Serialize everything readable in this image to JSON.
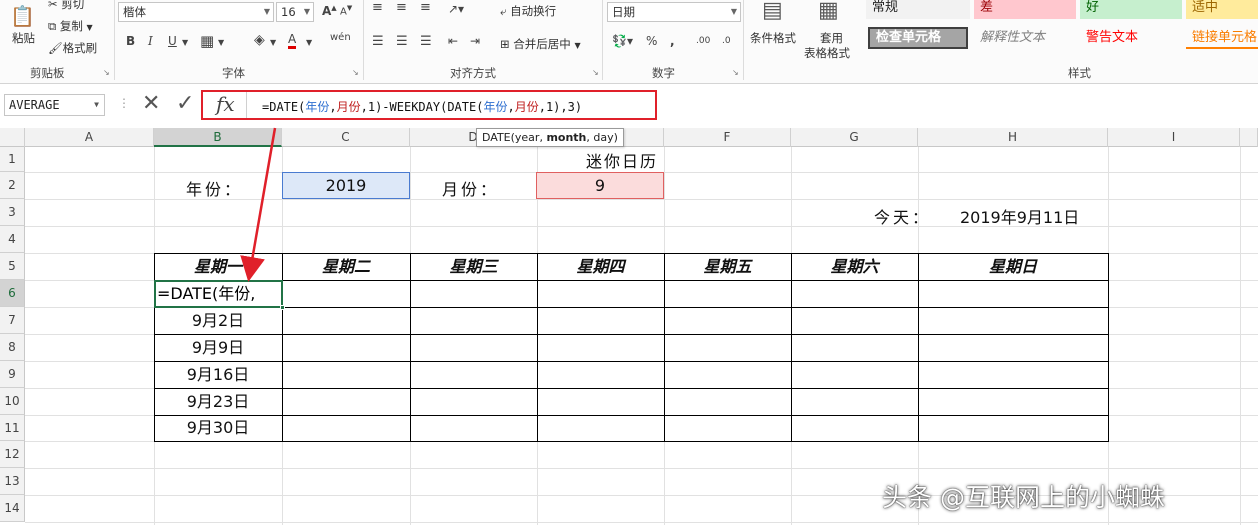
{
  "ribbon": {
    "clipboard": {
      "cut": "剪切",
      "copy": "复制",
      "paste": "粘贴",
      "format_painter": "格式刷",
      "label": "剪贴板"
    },
    "font": {
      "name": "楷体",
      "size": "16",
      "bold": "B",
      "italic": "I",
      "underline": "U",
      "grow": "A",
      "shrink": "A",
      "color_a": "A",
      "wen": "wén",
      "label": "字体"
    },
    "alignment": {
      "wrap": "自动换行",
      "merge": "合并后居中",
      "label": "对齐方式"
    },
    "number": {
      "format": "日期",
      "percent": "%",
      "comma": ",",
      "label": "数字"
    },
    "styles": {
      "conditional": "条件格式",
      "table_format_1": "套用",
      "table_format_2": "表格格式",
      "label": "样式",
      "cells": [
        "常规",
        "差",
        "好",
        "适中",
        "检查单元格",
        "解释性文本",
        "警告文本",
        "链接单元格"
      ]
    }
  },
  "formula_bar": {
    "name_box": "AVERAGE",
    "cancel": "✕",
    "enter": "✓",
    "fx": "fx",
    "tokens": [
      {
        "t": "=DATE(",
        "c": "n"
      },
      {
        "t": "年份",
        "c": "b"
      },
      {
        "t": ",",
        "c": "n"
      },
      {
        "t": "月份",
        "c": "r"
      },
      {
        "t": ",1)-WEEKDAY(DATE(",
        "c": "n"
      },
      {
        "t": "年份",
        "c": "b"
      },
      {
        "t": ",",
        "c": "n"
      },
      {
        "t": "月份",
        "c": "r"
      },
      {
        "t": ",1),3)",
        "c": "n"
      }
    ],
    "tooltip_pre": "DATE(year, ",
    "tooltip_bold": "month",
    "tooltip_post": ", day)"
  },
  "columns": [
    "A",
    "B",
    "C",
    "D",
    "E",
    "F",
    "G",
    "H",
    "I"
  ],
  "rows": [
    "1",
    "2",
    "3",
    "4",
    "5",
    "6",
    "7",
    "8",
    "9",
    "10",
    "11",
    "12",
    "13",
    "14"
  ],
  "sheet": {
    "title": "迷你日历",
    "year_label": "年份：",
    "year_value": "2019",
    "month_label": "月份：",
    "month_value": "9",
    "today_label": "今天：",
    "today_value": "2019年9月11日",
    "weekdays": [
      "星期一",
      "星期二",
      "星期三",
      "星期四",
      "星期五",
      "星期六",
      "星期日"
    ],
    "editing_cell": "=DATE(年份,",
    "mondays": [
      "9月2日",
      "9月9日",
      "9月16日",
      "9月23日",
      "9月30日"
    ]
  },
  "watermark": "头条 @互联网上的小蜘蛛",
  "colors": {
    "year_fill": "#dde8f8",
    "year_border": "#4a7bd0",
    "month_fill": "#fbdcdc",
    "month_border": "#e06060",
    "highlight_red": "#e0202a",
    "excel_green": "#217346"
  }
}
